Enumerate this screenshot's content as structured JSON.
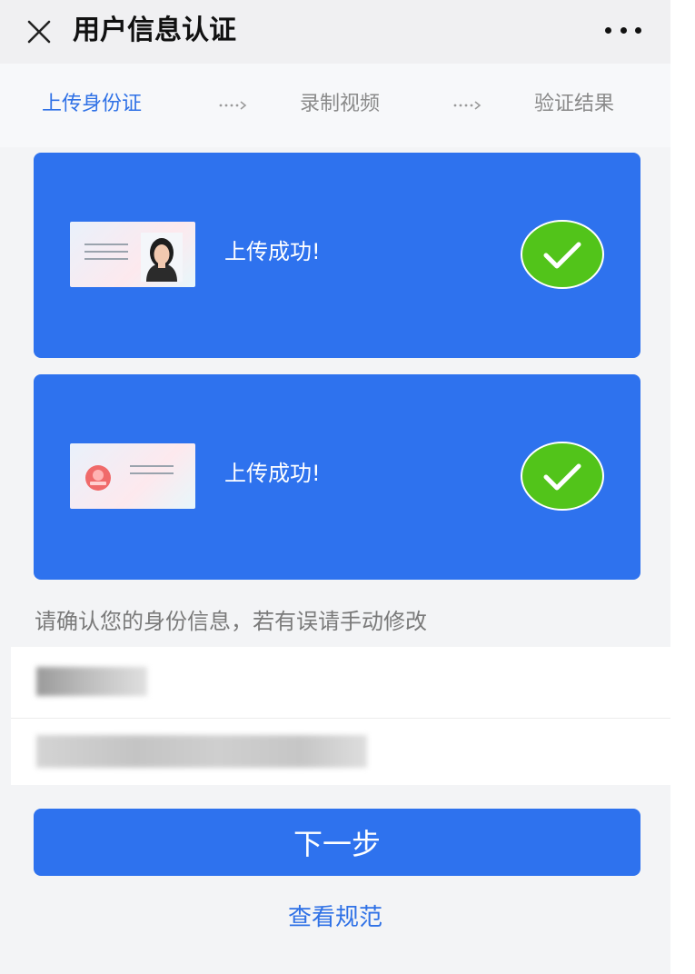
{
  "header": {
    "title": "用户信息认证",
    "close_icon": "close-icon",
    "more_icon": "more-dots-icon"
  },
  "steps": [
    {
      "label": "上传身份证",
      "state": "active"
    },
    {
      "label": "录制视频",
      "state": "inactive"
    },
    {
      "label": "验证结果",
      "state": "inactive"
    }
  ],
  "cards": [
    {
      "status": "上传成功!",
      "thumb_icon": "id-card-front-icon",
      "status_icon": "check-circle-icon"
    },
    {
      "status": "上传成功!",
      "thumb_icon": "id-card-back-icon",
      "status_icon": "check-circle-icon"
    }
  ],
  "confirm_label": "请确认您的身份信息，若有误请手动修改",
  "fields": [
    {
      "name": "name-field",
      "value": ""
    },
    {
      "name": "id-number-field",
      "value": ""
    }
  ],
  "actions": {
    "next_label": "下一步",
    "spec_link_label": "查看规范"
  },
  "colors": {
    "accent": "#2e72ee",
    "step_active": "#2f71e6",
    "success": "#52c41a"
  }
}
